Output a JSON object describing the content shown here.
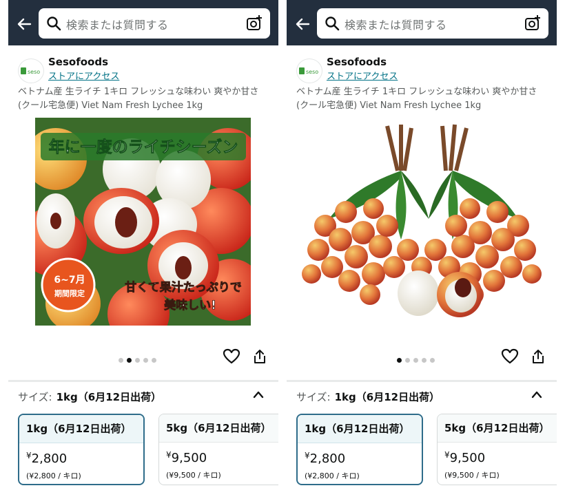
{
  "colors": {
    "topbar": "#232f3e",
    "link": "#007185",
    "selected_border": "#2e6c8a"
  },
  "panels": [
    {
      "search": {
        "placeholder": "検索または質問する",
        "left_icon": "back-arrow-icon",
        "camera_icon": "camera-search-icon"
      },
      "store": {
        "name": "Sesofoods",
        "link": "ストアにアクセス",
        "logo_text": "seso"
      },
      "product_title": "ベトナム産 生ライチ 1キロ フレッシュな味わい 爽やか甘さ (クール宅急便) Viet Nam Fresh Lychee 1kg",
      "image": {
        "banner": "年に一度のライチシーズン",
        "badge_line1": "6~7月",
        "badge_line2": "期間限定",
        "caption_line1": "甘くて果汁たっぷりで",
        "caption_line2": "美味しい!"
      },
      "carousel": {
        "count": 5,
        "active_index": 1
      },
      "size_label": "サイズ:",
      "size_value": "1kg（6月12日出荷）",
      "options": [
        {
          "label": "1kg（6月12日出荷）",
          "price_symbol": "¥",
          "price": "2,800",
          "unit": "(¥2,800 / キロ)",
          "selected": true
        },
        {
          "label": "5kg（6月12日出荷）",
          "price_symbol": "¥",
          "price": "9,500",
          "unit": "(¥9,500 / キロ)",
          "selected": false
        }
      ]
    },
    {
      "search": {
        "placeholder": "検索または質問する",
        "left_icon": "back-arrow-icon",
        "camera_icon": "camera-search-icon"
      },
      "store": {
        "name": "Sesofoods",
        "link": "ストアにアクセス",
        "logo_text": "seso"
      },
      "product_title": "ベトナム産 生ライチ 1キロ フレッシュな味わい 爽やか甘さ (クール宅急便) Viet Nam Fresh Lychee 1kg",
      "carousel": {
        "count": 5,
        "active_index": 0
      },
      "size_label": "サイズ:",
      "size_value": "1kg（6月12日出荷）",
      "options": [
        {
          "label": "1kg（6月12日出荷）",
          "price_symbol": "¥",
          "price": "2,800",
          "unit": "(¥2,800 / キロ)",
          "selected": true
        },
        {
          "label": "5kg（6月12日出荷）",
          "price_symbol": "¥",
          "price": "9,500",
          "unit": "(¥9,500 / キロ)",
          "selected": false
        }
      ]
    }
  ]
}
